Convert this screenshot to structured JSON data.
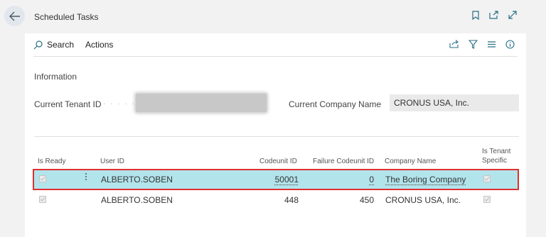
{
  "page": {
    "title": "Scheduled Tasks"
  },
  "actionbar": {
    "search_label": "Search",
    "actions_label": "Actions"
  },
  "information": {
    "section_title": "Information",
    "tenant_label": "Current Tenant ID",
    "company_label": "Current Company Name",
    "company_value": "CRONUS USA, Inc."
  },
  "table": {
    "headers": {
      "is_ready": "Is Ready",
      "user_id": "User ID",
      "codeunit_id": "Codeunit ID",
      "failure_codeunit_id": "Failure Codeunit ID",
      "company_name": "Company Name",
      "is_tenant_specific_1": "Is Tenant",
      "is_tenant_specific_2": "Specific"
    },
    "rows": [
      {
        "user_id": "ALBERTO.SOBEN",
        "codeunit_id": "50001",
        "failure_codeunit_id": "0",
        "company_name": "The Boring Company",
        "is_ready": true,
        "is_tenant_specific": true,
        "selected": true
      },
      {
        "user_id": "ALBERTO.SOBEN",
        "codeunit_id": "448",
        "failure_codeunit_id": "450",
        "company_name": "CRONUS USA, Inc.",
        "is_ready": true,
        "is_tenant_specific": true,
        "selected": false
      }
    ]
  },
  "colors": {
    "selected_row": "#b2e4ec",
    "highlight_outline": "#e03030",
    "accent_icon": "#2a6f85"
  },
  "icons": [
    "back-arrow-icon",
    "bookmark-icon",
    "open-new-window-icon",
    "expand-icon",
    "search-icon",
    "share-icon",
    "filter-icon",
    "list-view-icon",
    "info-icon",
    "checkbox-icon",
    "kebab-menu-icon"
  ]
}
